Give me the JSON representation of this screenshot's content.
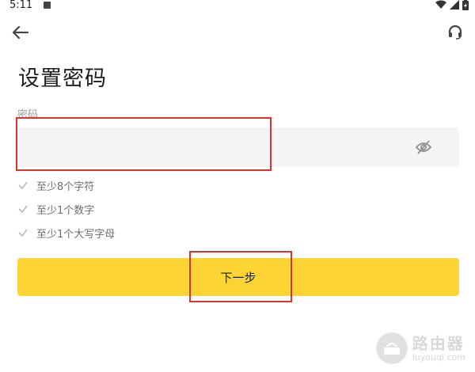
{
  "status_bar": {
    "time": "5:11"
  },
  "nav": {
    "back_icon": "arrow-left-icon",
    "support_icon": "headset-icon"
  },
  "page": {
    "title": "设置密码"
  },
  "password_field": {
    "label": "密码",
    "value": "",
    "visibility_icon": "eye-off-icon"
  },
  "rules": [
    {
      "text": "至少8个字符",
      "check_icon": "check-icon"
    },
    {
      "text": "至少1个数字",
      "check_icon": "check-icon"
    },
    {
      "text": "至少1个大写字母",
      "check_icon": "check-icon"
    }
  ],
  "next_button": {
    "label": "下一步"
  },
  "colors": {
    "accent": "#fcd535",
    "annotation": "#d9342b",
    "input_bg": "#f4f4f4"
  },
  "watermark": {
    "title": "路由器",
    "subtitle": "luyouqi.com"
  }
}
